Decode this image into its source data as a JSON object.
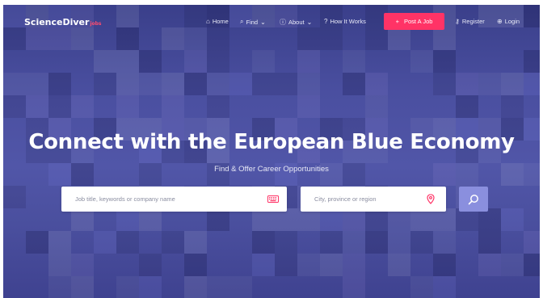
{
  "brand": {
    "name": "ScienceDiver",
    "suffix": "jobs",
    "accent": "#ff4b6e"
  },
  "nav": {
    "home": {
      "icon": "home-icon",
      "label": "Home"
    },
    "find": {
      "icon": "search-icon",
      "label": "Find"
    },
    "about": {
      "icon": "info-icon",
      "label": "About"
    },
    "how": {
      "icon": "question-icon",
      "label": "How It Works"
    },
    "post": {
      "icon": "plus-icon",
      "label": "Post A Job"
    },
    "register": {
      "icon": "key-icon",
      "label": "Register"
    },
    "login": {
      "icon": "login-icon",
      "label": "Login"
    }
  },
  "hero": {
    "title": "Connect with the European Blue Economy",
    "subtitle": "Find & Offer Career Opportunities"
  },
  "search": {
    "job_placeholder": "Job title, keywords or company name",
    "city_placeholder": "City, province or region",
    "keyboard_icon": "keyboard-icon",
    "location_icon": "location-pin-icon",
    "submit_icon": "search-icon"
  },
  "colors": {
    "background": "#4a4fa0",
    "post_button": "#ff3366",
    "search_button": "#8a8fde",
    "pin": "#ff3366"
  }
}
